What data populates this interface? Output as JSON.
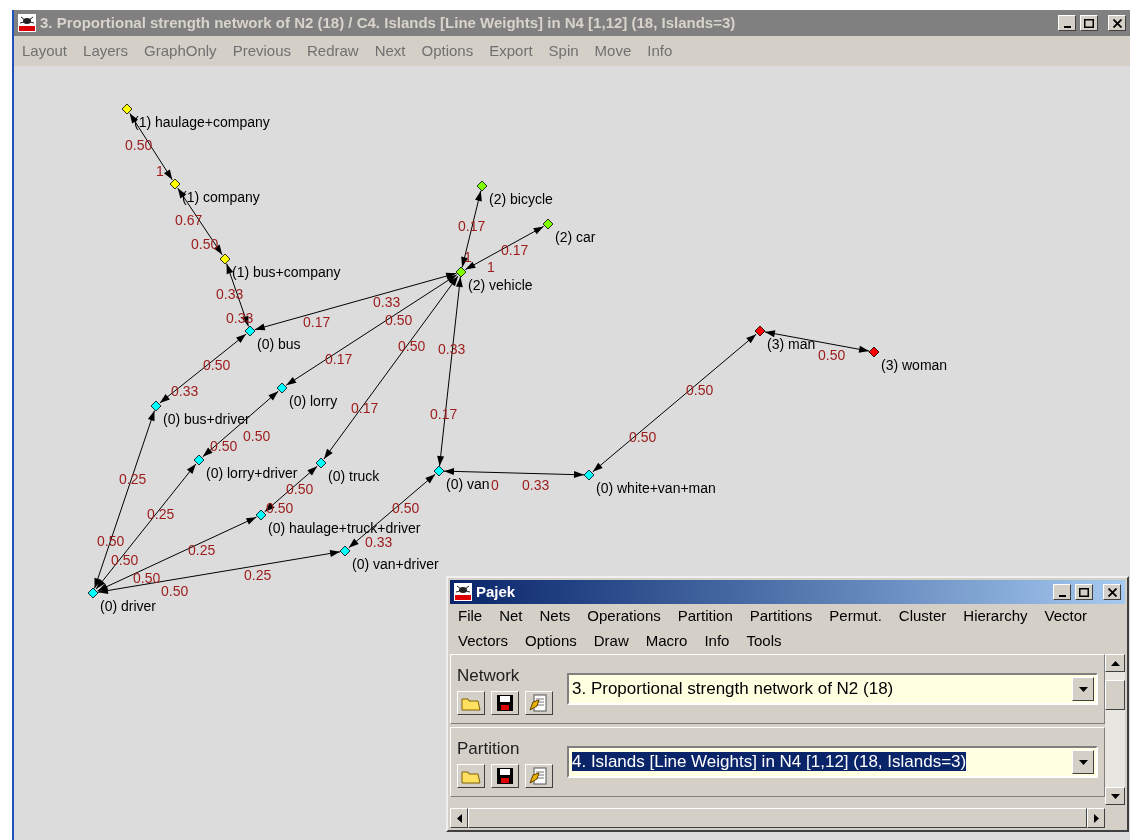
{
  "main_window": {
    "title": "3. Proportional strength network of N2 (18) / C4. Islands [Line Weights] in N4 [1,12] (18, Islands=3)",
    "menu": [
      "Layout",
      "Layers",
      "GraphOnly",
      "Previous",
      "Redraw",
      "Next",
      "Options",
      "Export",
      "Spin",
      "Move",
      "Info"
    ]
  },
  "graph": {
    "nodes": [
      {
        "label": "(1) haulage+company",
        "color": "#ffff00"
      },
      {
        "label": "(1) company",
        "color": "#ffff00"
      },
      {
        "label": "(1) bus+company",
        "color": "#ffff00"
      },
      {
        "label": "(2) bicycle",
        "color": "#80ff00"
      },
      {
        "label": "(2) car",
        "color": "#80ff00"
      },
      {
        "label": "(2) vehicle",
        "color": "#80ff00"
      },
      {
        "label": "(0) bus",
        "color": "#00ffff"
      },
      {
        "label": "(0) lorry",
        "color": "#00ffff"
      },
      {
        "label": "(0) bus+driver",
        "color": "#00ffff"
      },
      {
        "label": "(0) lorry+driver",
        "color": "#00ffff"
      },
      {
        "label": "(0) truck",
        "color": "#00ffff"
      },
      {
        "label": "(0) van",
        "color": "#00ffff"
      },
      {
        "label": "(0) white+van+man",
        "color": "#00ffff"
      },
      {
        "label": "(3) man",
        "color": "#ff0000"
      },
      {
        "label": "(3) woman",
        "color": "#ff0000"
      },
      {
        "label": "(0) haulage+truck+driver",
        "color": "#00ffff"
      },
      {
        "label": "(0) van+driver",
        "color": "#00ffff"
      },
      {
        "label": "(0) driver",
        "color": "#00ffff"
      }
    ],
    "edges": [
      {
        "weights": [
          "0.50",
          "1"
        ]
      },
      {
        "weights": [
          "0.67",
          "0.50"
        ]
      },
      {
        "weights": [
          "0.17",
          "1"
        ]
      },
      {
        "weights": [
          "0.17",
          "1"
        ]
      },
      {
        "weights": [
          "0.33",
          "0.33"
        ]
      },
      {
        "weights": [
          "0.33",
          "0.17"
        ]
      },
      {
        "weights": [
          "0.50",
          "0.17"
        ]
      },
      {
        "weights": [
          "0.50"
        ]
      },
      {
        "weights": [
          "0.50",
          "0.33"
        ]
      },
      {
        "weights": [
          "0.50",
          "0.17"
        ]
      },
      {
        "weights": [
          "0.33",
          "0.17"
        ]
      },
      {
        "weights": [
          "0.50",
          "0.50"
        ]
      },
      {
        "weights": [
          "0.50",
          "0.50"
        ]
      },
      {
        "weights": [
          "0",
          "0.33"
        ]
      },
      {
        "weights": [
          "0.50",
          "0.50"
        ]
      },
      {
        "weights": [
          "0.50",
          "0.25"
        ]
      },
      {
        "weights": [
          "0.50",
          "0.25"
        ]
      },
      {
        "weights": [
          "0.50",
          "0.33"
        ]
      },
      {
        "weights": [
          "0.50",
          "0.25"
        ]
      },
      {
        "weights": [
          "0.50",
          "0.25"
        ]
      }
    ]
  },
  "pajek_window": {
    "title": "Pajek",
    "menu_rows": [
      [
        "File",
        "Net",
        "Nets",
        "Operations",
        "Partition",
        "Partitions",
        "Permut.",
        "Cluster",
        "Hierarchy",
        "Vector"
      ],
      [
        "Vectors",
        "Options",
        "Draw",
        "Macro",
        "Info",
        "Tools"
      ]
    ],
    "sections": [
      {
        "label": "Network",
        "value": "3. Proportional strength network of N2 (18)",
        "selected": false
      },
      {
        "label": "Partition",
        "value": "4. Islands [Line Weights] in N4 [1,12] (18, Islands=3)",
        "selected": true
      }
    ]
  }
}
